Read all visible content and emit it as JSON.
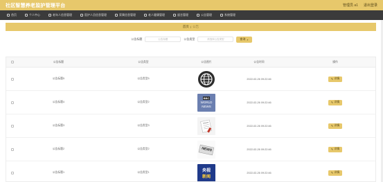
{
  "app": {
    "title": "社区智慧养老监护管理平台"
  },
  "topbar": {
    "user": "管理员 a1",
    "logout": "退出登录"
  },
  "nav": [
    {
      "label": "首页"
    },
    {
      "label": "个人中心"
    },
    {
      "label": "老年人信息管理"
    },
    {
      "label": "医护人员信息管理"
    },
    {
      "label": "家属信息管理"
    },
    {
      "label": "老人健康管理"
    },
    {
      "label": "留言管理"
    },
    {
      "label": "公告管理"
    },
    {
      "label": "系统管理"
    }
  ],
  "breadcrumb": {
    "home": "首页",
    "current": "公告"
  },
  "search": {
    "title_label": "公告标题",
    "title_placeholder": "公告标题",
    "type_label": "公告类型",
    "type_placeholder": "请选择公告类型",
    "button": "查询"
  },
  "table": {
    "headers": [
      "公告标题",
      "公告类型",
      "公告图片",
      "公告时间",
      "操作"
    ],
    "rows": [
      {
        "title": "公告标题5",
        "type": "公告类型5",
        "time": "2022-02-26 09:22:46",
        "action": "详情",
        "img": "globe"
      },
      {
        "title": "公告标题4",
        "type": "公告类型2",
        "time": "2022-02-26 09:22:46",
        "action": "详情",
        "img": "bbc"
      },
      {
        "title": "公告标题3",
        "type": "公告类型3",
        "time": "2022-02-26 09:22:46",
        "action": "详情",
        "img": "paper"
      },
      {
        "title": "公告标题2",
        "type": "公告类型2",
        "time": "2022-02-26 09:22:46",
        "action": "详情",
        "img": "news"
      },
      {
        "title": "公告标题1",
        "type": "公告类型1",
        "time": "2022-02-26 09:22:46",
        "action": "详情",
        "img": "cctv"
      }
    ],
    "images": {
      "bbc_top": "BBC",
      "bbc_mid": "WORLD",
      "bbc_bot": "NEWS",
      "news_word": "NEWS",
      "cctv_top": "央视",
      "cctv_bot": "新闻"
    }
  },
  "colors": {
    "accent": "#e7c86b",
    "nav_bg": "#3b3b3b"
  }
}
